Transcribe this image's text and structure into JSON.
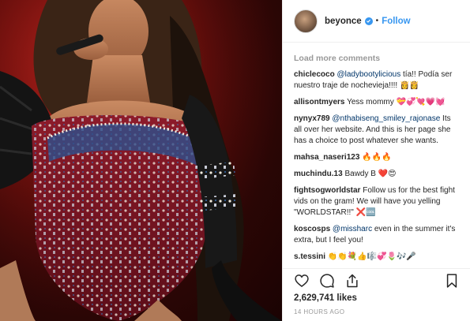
{
  "post": {
    "username": "beyonce",
    "separator": "•",
    "follow_label": "Follow",
    "verified_icon": "verified-badge-icon"
  },
  "comments_section": {
    "load_more_label": "Load more comments",
    "items": [
      {
        "user": "chiclecoco",
        "mention": "@ladybootylicious",
        "text": " tía!! Podía ser nuestro traje de nochevieja!!!! ",
        "emoji": "👸👸"
      },
      {
        "user": "allisontmyers",
        "mention": "",
        "text": " Yess mommy ",
        "emoji": "💝💞💘💗💓"
      },
      {
        "user": "nynyx789",
        "mention": "@nthabiseng_smiley_rajonase",
        "text": " Its all over her website. And this is her page she has a choice to post whatever she wants.",
        "emoji": ""
      },
      {
        "user": "mahsa_naseri123",
        "mention": "",
        "text": " ",
        "emoji": "🔥🔥🔥"
      },
      {
        "user": "muchindu.13",
        "mention": "",
        "text": " Bawdy B ",
        "emoji": "❤️😍"
      },
      {
        "user": "fightsogworldstar",
        "mention": "",
        "text": " Follow us for the best fight vids on the gram! We will have you yelling \"WORLDSTAR!!\" ",
        "emoji": "❌🆒"
      },
      {
        "user": "koscosps",
        "mention": "@missharc",
        "text": " even in the summer it's extra, but I feel you!",
        "emoji": ""
      },
      {
        "user": "s.tessini",
        "mention": "",
        "text": " ",
        "emoji": "👏👏💐👍🎼💞🌷🎶🎤"
      }
    ]
  },
  "actions": {
    "like_icon": "heart-icon",
    "comment_icon": "comment-icon",
    "share_icon": "share-icon",
    "save_icon": "bookmark-icon"
  },
  "likes_count": "2,629,741 likes",
  "timestamp": "14 HOURS AGO",
  "colors": {
    "link_blue": "#3897f0",
    "mention_blue": "#003569",
    "muted_gray": "#999999",
    "text": "#262626",
    "stage_red": "#8f1a17"
  }
}
